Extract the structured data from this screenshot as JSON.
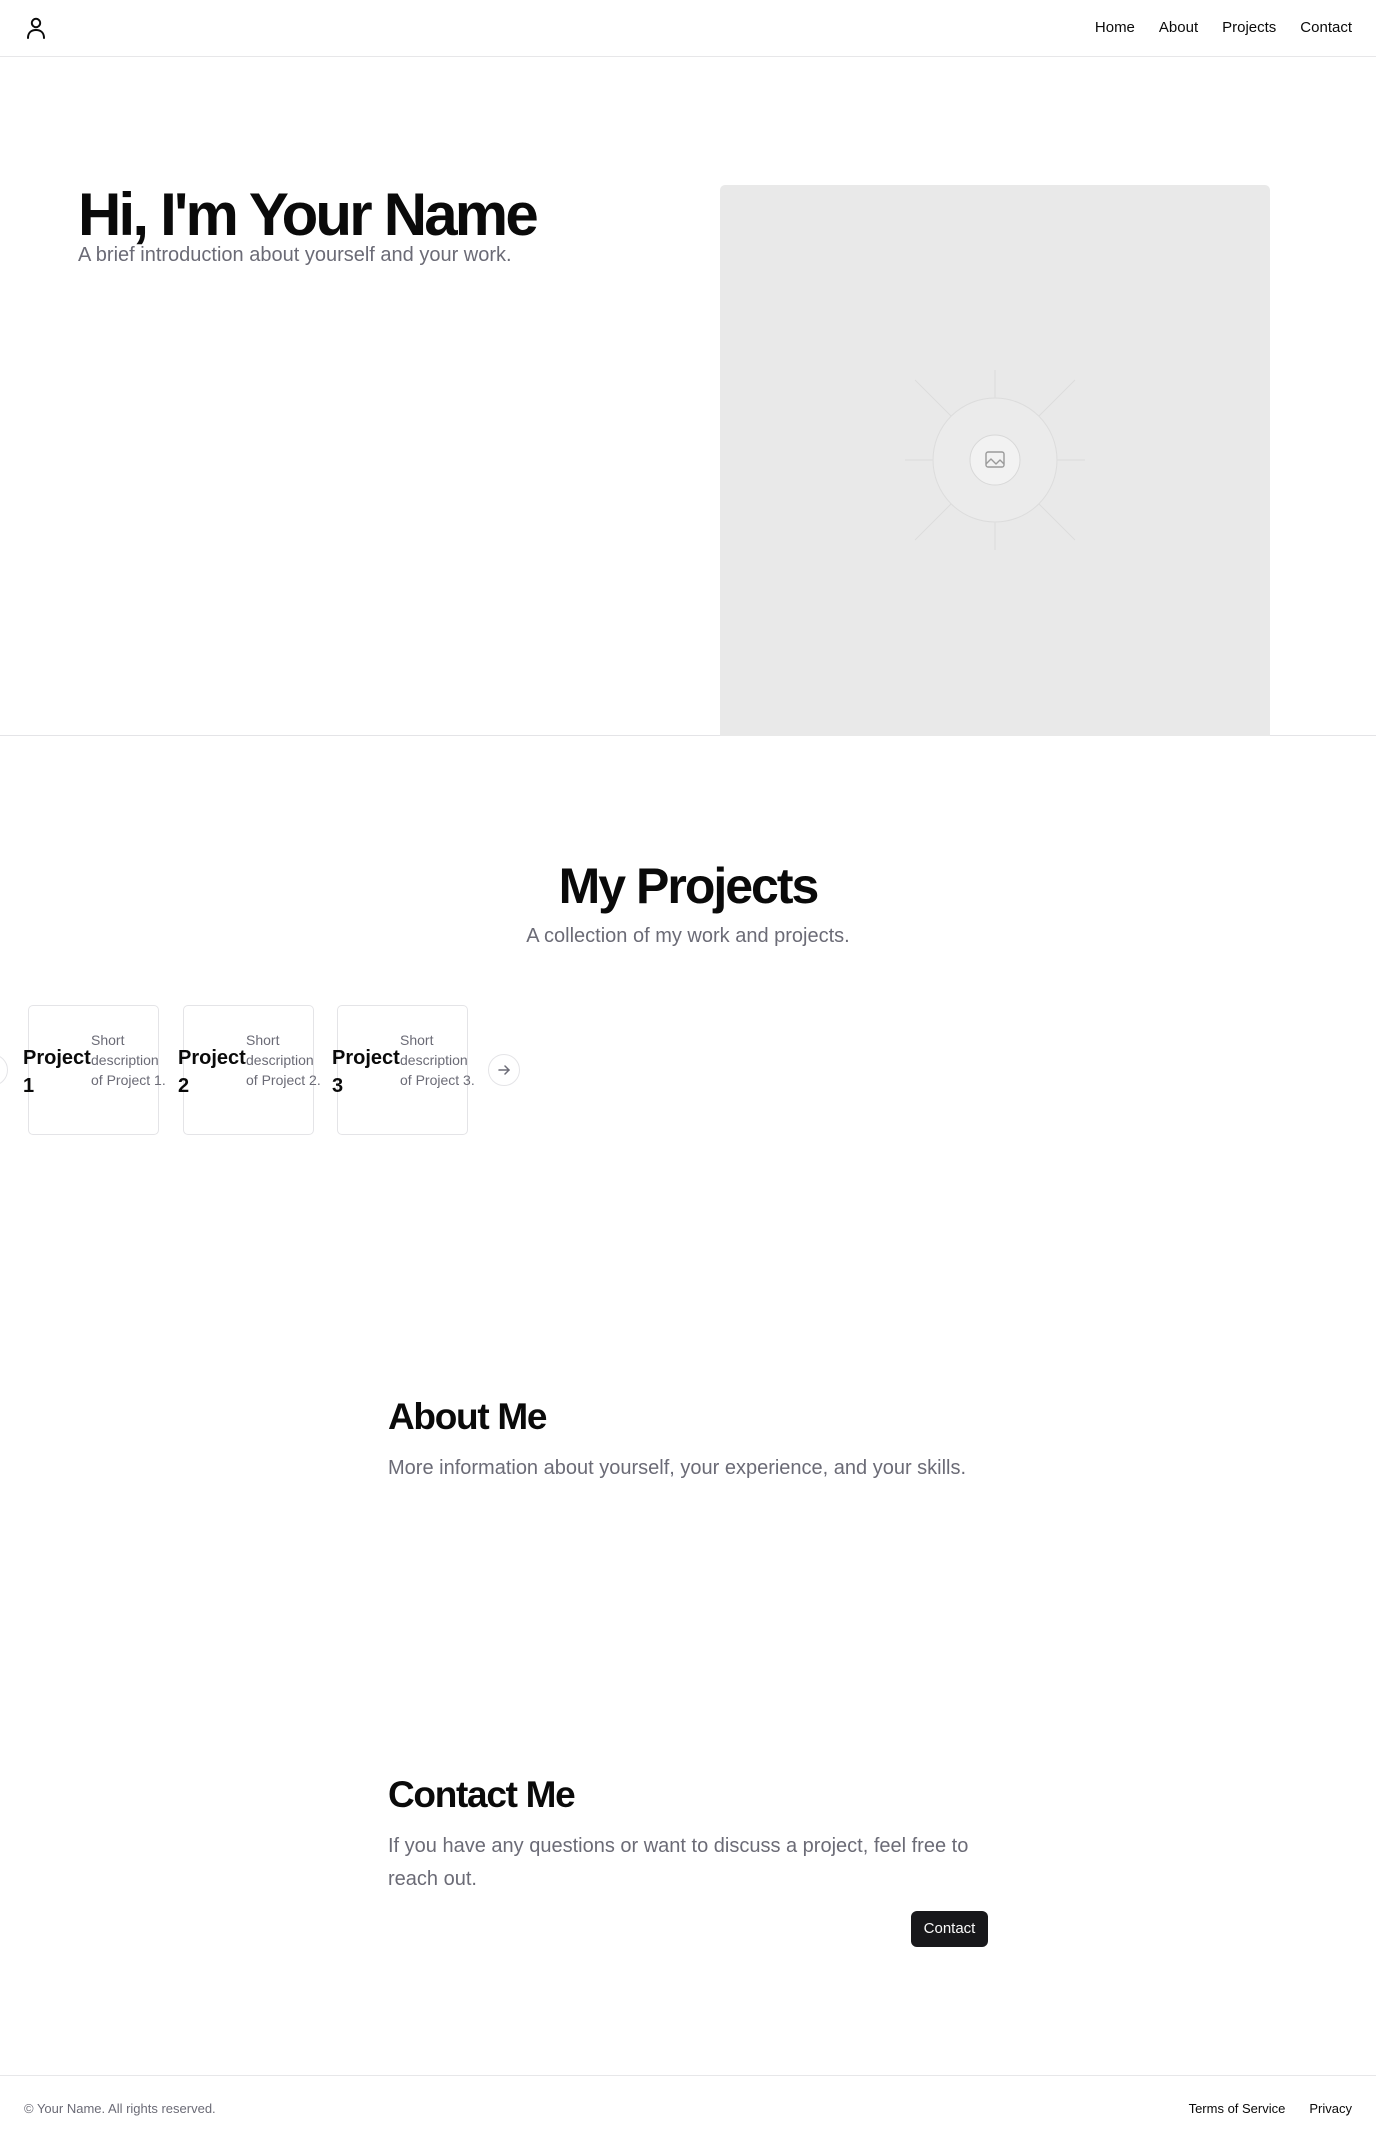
{
  "header": {
    "logo_icon": "user-icon",
    "nav": [
      {
        "label": "Home"
      },
      {
        "label": "About"
      },
      {
        "label": "Projects"
      },
      {
        "label": "Contact"
      }
    ]
  },
  "hero": {
    "title": "Hi, I'm Your Name",
    "subtitle": "A brief introduction about yourself and your work.",
    "image_icon": "image-placeholder-icon"
  },
  "projects": {
    "title": "My Projects",
    "subtitle": "A collection of my work and projects.",
    "items": [
      {
        "title": "Project 1",
        "description": "Short description of Project 1."
      },
      {
        "title": "Project 2",
        "description": "Short description of Project 2."
      },
      {
        "title": "Project 3",
        "description": "Short description of Project 3."
      }
    ],
    "prev_icon": "arrow-left-icon",
    "next_icon": "arrow-right-icon"
  },
  "about": {
    "title": "About Me",
    "text": "More information about yourself, your experience, and your skills."
  },
  "contact": {
    "title": "Contact Me",
    "text": "If you have any questions or want to discuss a project, feel free to reach out.",
    "button_label": "Contact"
  },
  "footer": {
    "copyright": "© Your Name. All rights reserved.",
    "links": [
      {
        "label": "Terms of Service"
      },
      {
        "label": "Privacy"
      }
    ]
  },
  "colors": {
    "primary": "#18181b",
    "muted_text": "#6b6b76",
    "border": "#e4e4e7",
    "placeholder_bg": "#e9e9e9"
  }
}
